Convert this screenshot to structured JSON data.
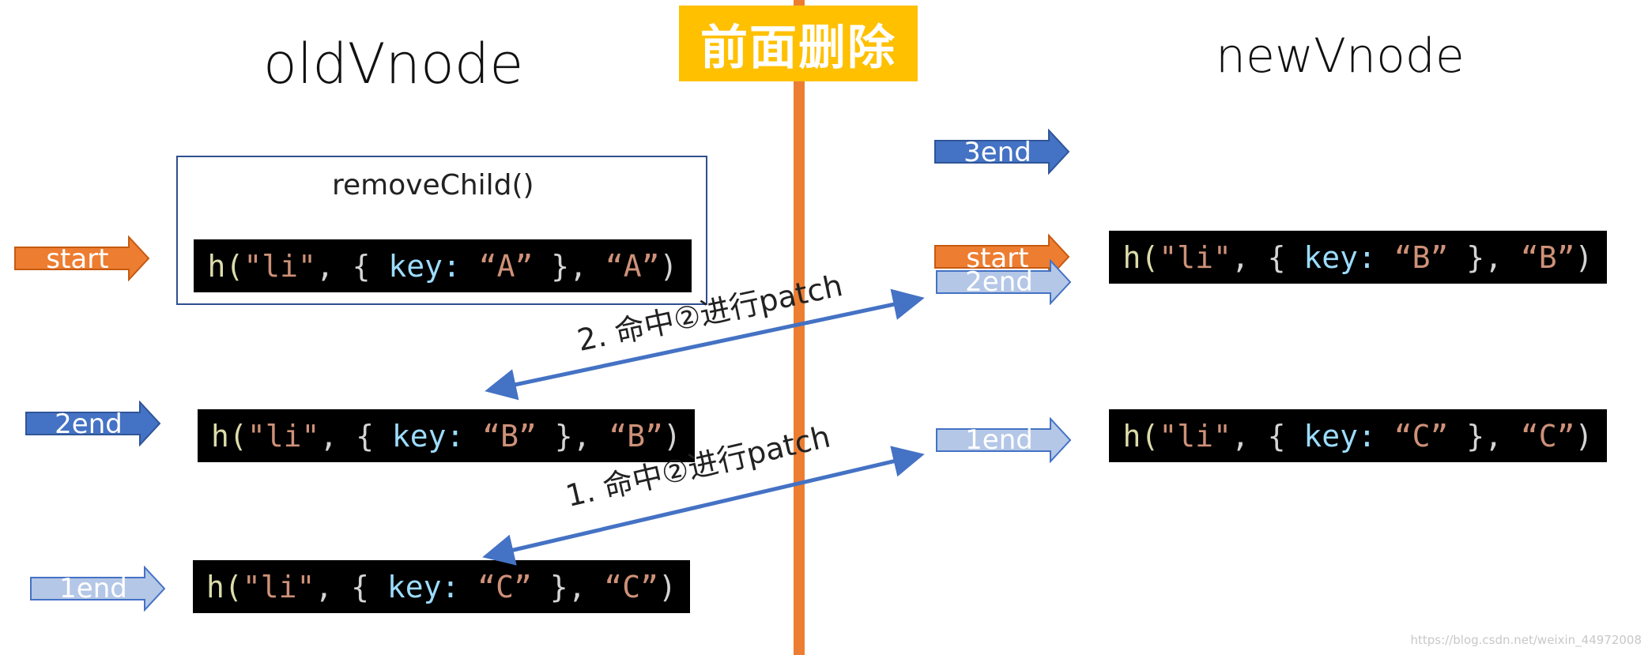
{
  "titles": {
    "old": "oldVnode",
    "new": "newVnode",
    "banner": "前面删除"
  },
  "remove_child": "removeChild()",
  "code_token": {
    "open": "h(",
    "tag": "\"li\"",
    "brace_open": ", { ",
    "key_label": "key:",
    "brace_close": " }, ",
    "close": ")"
  },
  "old_nodes": [
    {
      "key": "“A”",
      "text": "“A”"
    },
    {
      "key": "“B”",
      "text": "“B”"
    },
    {
      "key": "“C”",
      "text": "“C”"
    }
  ],
  "new_nodes": [
    {
      "key": "“B”",
      "text": "“B”"
    },
    {
      "key": "“C”",
      "text": "“C”"
    }
  ],
  "pointers": {
    "old_start": "start",
    "old_2end": "2end",
    "old_1end": "1end",
    "new_3end": "3end",
    "new_start": "start",
    "new_2end": "2end",
    "new_1end": "1end"
  },
  "patch_labels": {
    "second": "2. 命中②进行patch",
    "first": "1. 命中②进行patch"
  },
  "watermark": "https://blog.csdn.net/weixin_44972008",
  "colors": {
    "divider": "#ed7d31",
    "banner": "#ffc000",
    "arrow_orange": "#ed7d31",
    "arrow_blue": "#4472c4",
    "arrow_lightblue": "#b4c7e7",
    "connector": "#4472c4"
  }
}
